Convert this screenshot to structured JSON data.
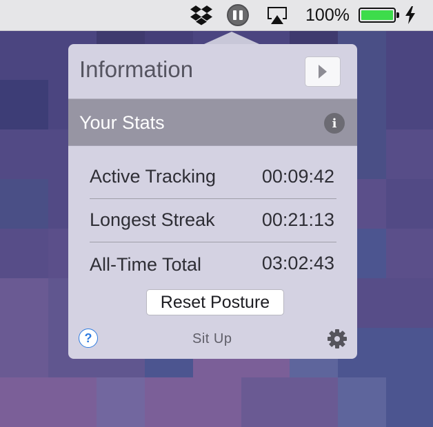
{
  "menubar": {
    "icons": [
      "dropbox-icon",
      "pause-icon",
      "airplay-icon",
      "battery-icon",
      "charging-bolt-icon"
    ],
    "battery_percent": "100%",
    "battery_level": 1.0,
    "battery_color": "#3ddc4b"
  },
  "popover": {
    "title": "Information",
    "next_icon": "play-triangle-icon",
    "stats_header": "Your Stats",
    "stats_info_glyph": "i",
    "stats": [
      {
        "label": "Active Tracking",
        "value": "00:09:42"
      },
      {
        "label": "Longest Streak",
        "value": "00:21:13"
      },
      {
        "label": "All-Time Total",
        "value": "03:02:43"
      }
    ],
    "reset_label": "Reset Posture",
    "help_glyph": "?",
    "app_name": "Sit Up",
    "settings_icon": "gear-icon"
  }
}
